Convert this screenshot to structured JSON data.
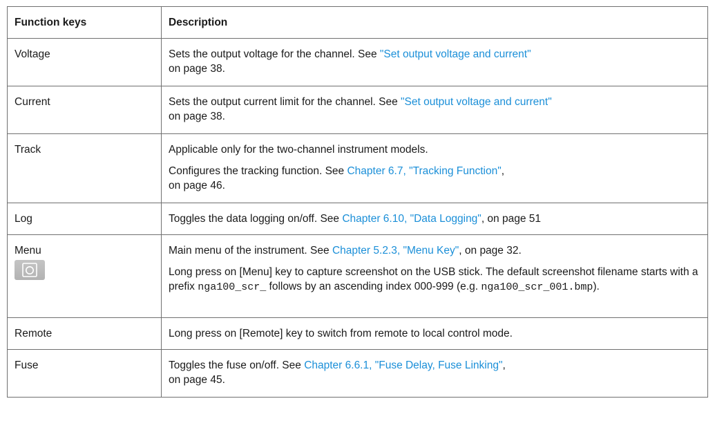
{
  "table": {
    "headers": [
      "Function keys",
      "Description"
    ],
    "rows": [
      {
        "key": "Voltage",
        "desc": [
          {
            "text": "Sets the output voltage for the channel. See ",
            "link": "\"Set output voltage and current\"",
            "line2": "on page 38."
          }
        ]
      },
      {
        "key": "Current",
        "desc": [
          {
            "text": "Sets the output current limit for the channel. See ",
            "link": "\"Set output voltage and current\"",
            "line2": "on page 38."
          }
        ]
      },
      {
        "key": "Track",
        "desc": [
          {
            "text": "Applicable only for the two-channel instrument models."
          },
          {
            "text": "Configures the tracking function. See ",
            "link": "Chapter 6.7, \"Tracking Function\"",
            "tail": ",",
            "line2": "on page 46."
          }
        ]
      },
      {
        "key": "Log",
        "desc": [
          {
            "text": "Toggles the data logging on/off. See ",
            "link": "Chapter 6.10, \"Data Logging\"",
            "tail": ", on page 51"
          }
        ]
      },
      {
        "key": "Menu",
        "icon": "camera-icon",
        "desc": [
          {
            "text": "Main menu of the instrument. See ",
            "link": "Chapter 5.2.3, \"Menu Key\"",
            "tail": ", on page 32."
          },
          {
            "p1": "Long press on [Menu] key to capture screenshot on the USB stick. The default screenshot filename starts with a prefix ",
            "code1": "nga100_scr_",
            "p2": " follows by an ascending index 000-999 (e.g. ",
            "code2": "nga100_scr_001.bmp",
            "p3": ")."
          }
        ]
      },
      {
        "key": "Remote",
        "desc": [
          {
            "text": "Long press on [Remote] key to switch from remote to local control mode."
          }
        ]
      },
      {
        "key": "Fuse",
        "desc": [
          {
            "text": "Toggles the fuse on/off. See ",
            "link": "Chapter 6.6.1, \"Fuse Delay, Fuse Linking\"",
            "tail": ",",
            "line2": "on page 45."
          }
        ]
      }
    ]
  },
  "colors": {
    "link": "#1b8fd8",
    "border": "#6f6f6f",
    "text": "#1a1a1a"
  }
}
